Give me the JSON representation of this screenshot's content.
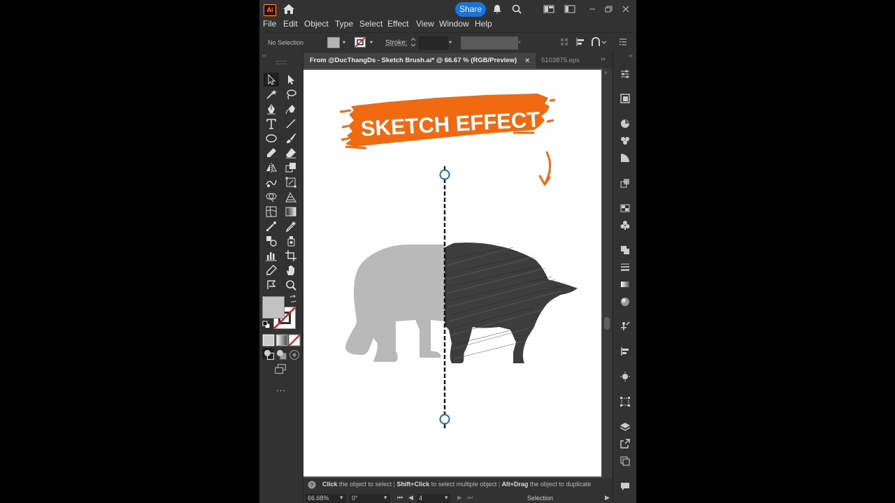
{
  "app": {
    "logo_text": "Ai",
    "share_label": "Share"
  },
  "menu": [
    "File",
    "Edit",
    "Object",
    "Type",
    "Select",
    "Effect",
    "View",
    "Window",
    "Help"
  ],
  "control_bar": {
    "selection": "No Selection",
    "stroke_label": "Stroke:"
  },
  "tabs": {
    "active": "From @DucThangDs - Sketch Brush.ai* @ 66.67 % (RGB/Preview)",
    "close": "×",
    "inactive": "5103875.eps"
  },
  "artwork": {
    "banner_text": "SKETCH EFFECT",
    "banner_color": "#f06a12",
    "bear_left_color": "#b9b9b9",
    "bear_right_color": "#3d3d3d",
    "guide_handle_color": "#1f6fa8"
  },
  "status": {
    "hint_click": "Click",
    "hint_click_text": "the object to select",
    "hint_shift": "Shift+Click",
    "hint_shift_text": "to select multiple object",
    "hint_alt": "Alt+Drag",
    "hint_alt_text": "the object to duplicate",
    "zoom": "66.68%",
    "rotation": "0°",
    "artboard_number": "4",
    "tool_name": "Selection"
  },
  "tools_panel": {
    "more_label": "..."
  }
}
